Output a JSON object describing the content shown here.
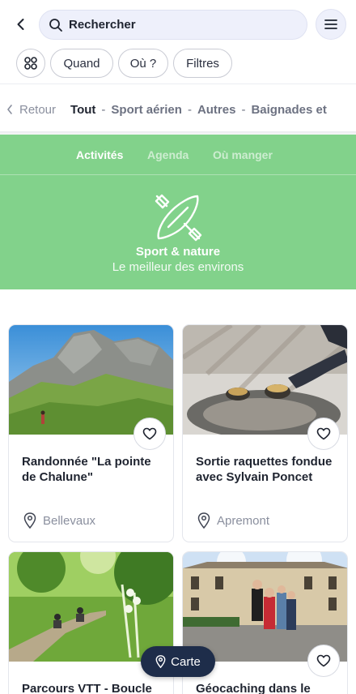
{
  "search": {
    "placeholder": "Rechercher"
  },
  "icons": {
    "back": "chevron-left-icon",
    "search": "search-icon",
    "menu": "hamburger-menu-icon",
    "categories": "grid-icon",
    "heart": "heart-icon",
    "pin": "map-pin-icon",
    "kayak": "kayak-paddle-icon"
  },
  "filters": {
    "chips": [
      "Quand",
      "Où ?",
      "Filtres"
    ]
  },
  "breadcrumb": {
    "back_label": "Retour",
    "current": "Tout",
    "items": [
      "Sport aérien",
      "Autres",
      "Baignades et"
    ]
  },
  "hero": {
    "tabs": [
      "Activités",
      "Agenda",
      "Où manger"
    ],
    "active_tab": "Activités",
    "title": "Sport & nature",
    "subtitle": "Le meilleur des environs",
    "background_color": "#82d28b"
  },
  "cards": [
    {
      "title": "Randonnée \"La pointe de Chalune\"",
      "location": "Bellevaux"
    },
    {
      "title": "Sortie raquettes fondue avec Sylvain Poncet",
      "location": "Apremont"
    },
    {
      "title": "Parcours VTT - Boucle",
      "location": ""
    },
    {
      "title": "Géocaching dans le",
      "location": ""
    }
  ],
  "map_button": {
    "label": "Carte"
  }
}
